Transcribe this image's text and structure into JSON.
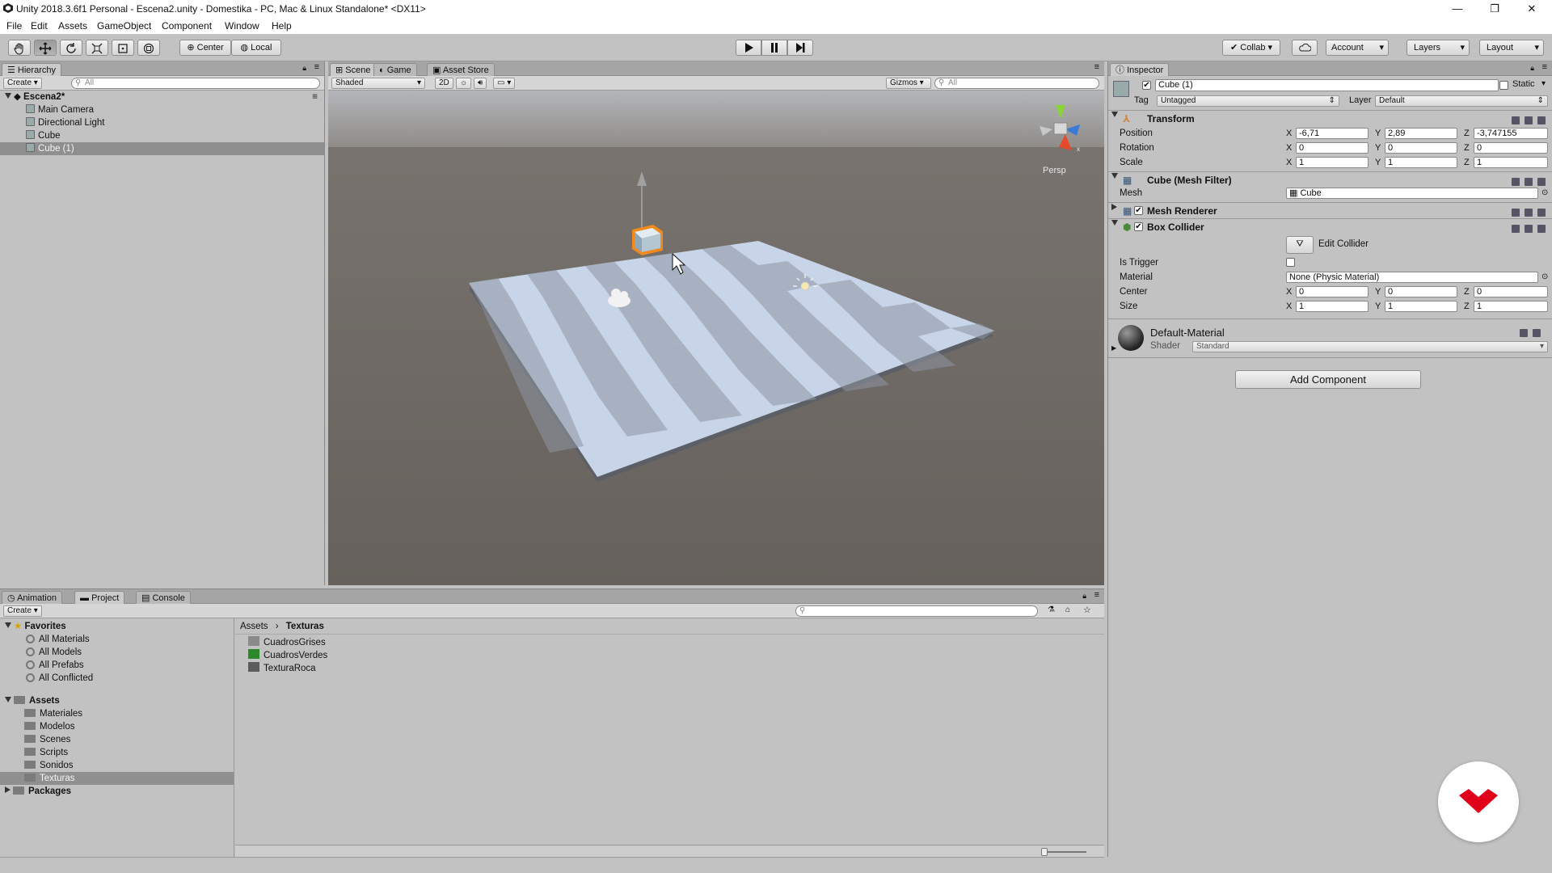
{
  "window": {
    "title": "Unity 2018.3.6f1 Personal - Escena2.unity - Domestika - PC, Mac & Linux Standalone* <DX11>",
    "minimize": "—",
    "maximize": "❐",
    "close": "✕"
  },
  "menu": [
    "File",
    "Edit",
    "Assets",
    "GameObject",
    "Component",
    "Window",
    "Help"
  ],
  "toolbar": {
    "tools": [
      "hand-tool",
      "move-tool",
      "rotate-tool",
      "scale-tool",
      "rect-tool",
      "transform-tool"
    ],
    "pivot": "Center",
    "space": "Local",
    "collab": "Collab",
    "account": "Account",
    "layers": "Layers",
    "layout": "Layout"
  },
  "hierarchy": {
    "tab": "Hierarchy",
    "create": "Create",
    "search_placeholder": "All",
    "scene": "Escena2*",
    "items": [
      "Main Camera",
      "Directional Light",
      "Cube",
      "Cube (1)"
    ],
    "selected_index": 3
  },
  "scene": {
    "tabs": [
      "Scene",
      "Game",
      "Asset Store"
    ],
    "active_tab": "Scene",
    "shading": "Shaded",
    "mode_2d": "2D",
    "gizmos": "Gizmos",
    "search_placeholder": "All",
    "persp": "Persp"
  },
  "inspector": {
    "tab": "Inspector",
    "object_name": "Cube (1)",
    "static_label": "Static",
    "tag_label": "Tag",
    "tag": "Untagged",
    "layer_label": "Layer",
    "layer": "Default",
    "transform": {
      "title": "Transform",
      "position_label": "Position",
      "rotation_label": "Rotation",
      "scale_label": "Scale",
      "position": [
        "-6,71",
        "2,89",
        "-3,747155"
      ],
      "rotation": [
        "0",
        "0",
        "0"
      ],
      "scale": [
        "1",
        "1",
        "1"
      ]
    },
    "mesh_filter": {
      "title": "Cube (Mesh Filter)",
      "mesh_label": "Mesh",
      "mesh": "Cube"
    },
    "mesh_renderer": {
      "title": "Mesh Renderer"
    },
    "box_collider": {
      "title": "Box Collider",
      "edit_collider": "Edit Collider",
      "is_trigger_label": "Is Trigger",
      "material_label": "Material",
      "material": "None (Physic Material)",
      "center_label": "Center",
      "center": [
        "0",
        "0",
        "0"
      ],
      "size_label": "Size",
      "size": [
        "1",
        "1",
        "1"
      ]
    },
    "material": {
      "name": "Default-Material",
      "shader_label": "Shader",
      "shader": "Standard"
    },
    "add_component": "Add Component"
  },
  "bottom": {
    "tabs": [
      "Animation",
      "Project",
      "Console"
    ],
    "active_tab": "Project",
    "create": "Create",
    "favorites_label": "Favorites",
    "favorites": [
      "All Materials",
      "All Models",
      "All Prefabs",
      "All Conflicted"
    ],
    "assets_label": "Assets",
    "asset_folders": [
      "Materiales",
      "Modelos",
      "Scenes",
      "Scripts",
      "Sonidos",
      "Texturas"
    ],
    "selected_folder": "Texturas",
    "packages_label": "Packages",
    "breadcrumb": [
      "Assets",
      "Texturas"
    ],
    "files": [
      {
        "name": "CuadrosGrises",
        "color": "#8a8a8a"
      },
      {
        "name": "CuadrosVerdes",
        "color": "#2a8a2a"
      },
      {
        "name": "TexturaRoca",
        "color": "#5c5c5c"
      }
    ]
  },
  "colors": {
    "panel": "#c2c2c2",
    "selection": "#8f8f8f",
    "scene_sky": "#b2b2b2",
    "scene_ground": "#6b6661",
    "gizmo_orange": "#f08a1c",
    "watermark": "#e1001a"
  }
}
